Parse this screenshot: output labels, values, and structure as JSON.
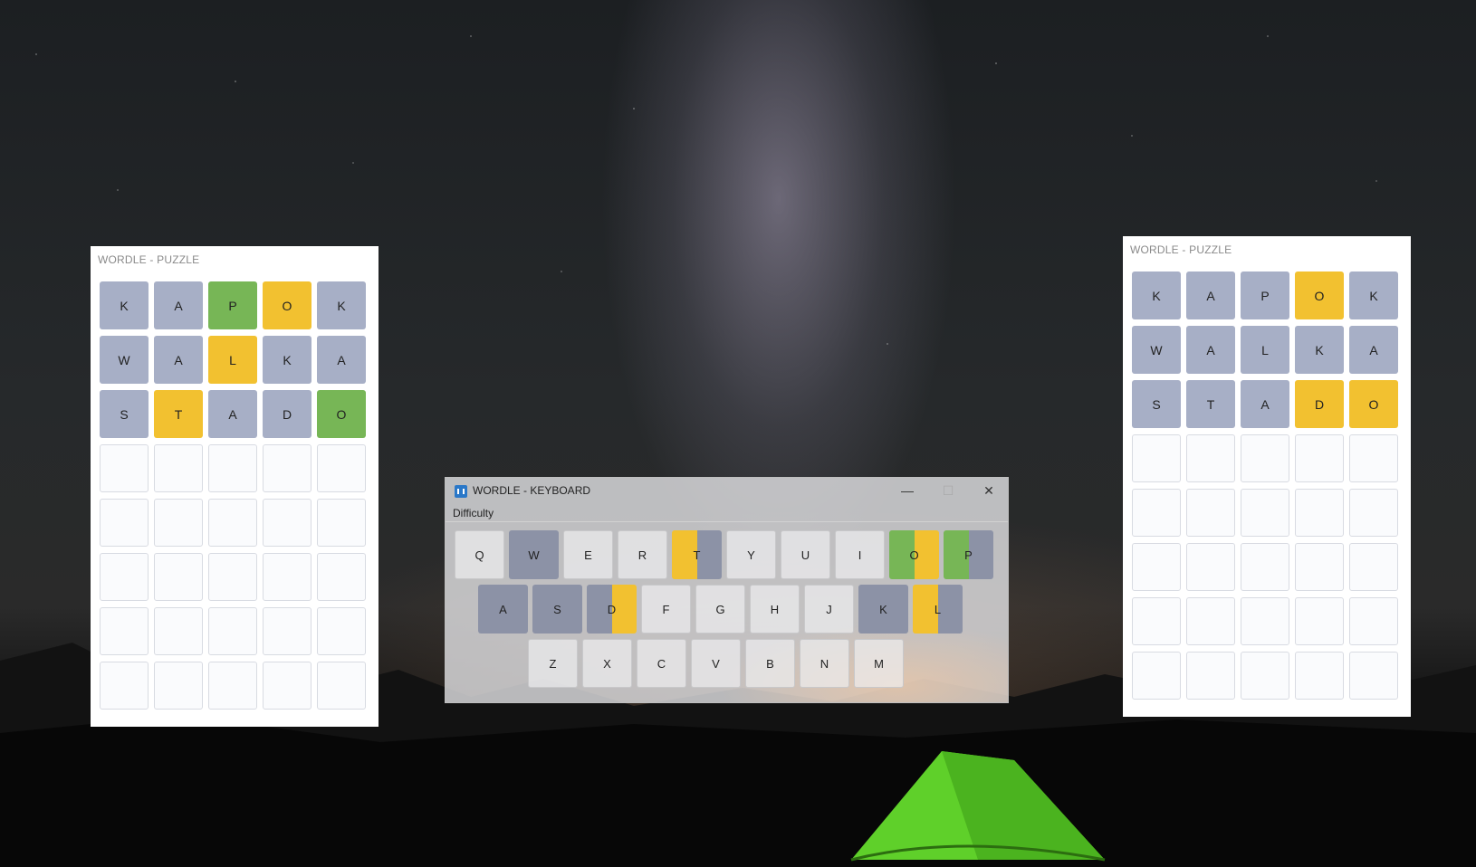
{
  "colors": {
    "gray": "#a7afc6",
    "yellow": "#f2c130",
    "green": "#77b656",
    "key_gray": "#8c92a6"
  },
  "left_puzzle": {
    "title": "WORDLE - PUZZLE",
    "rows": [
      [
        {
          "l": "K",
          "s": "gray"
        },
        {
          "l": "A",
          "s": "gray"
        },
        {
          "l": "P",
          "s": "green"
        },
        {
          "l": "O",
          "s": "yellow"
        },
        {
          "l": "K",
          "s": "gray"
        }
      ],
      [
        {
          "l": "W",
          "s": "gray"
        },
        {
          "l": "A",
          "s": "gray"
        },
        {
          "l": "L",
          "s": "yellow"
        },
        {
          "l": "K",
          "s": "gray"
        },
        {
          "l": "A",
          "s": "gray"
        }
      ],
      [
        {
          "l": "S",
          "s": "gray"
        },
        {
          "l": "T",
          "s": "yellow"
        },
        {
          "l": "A",
          "s": "gray"
        },
        {
          "l": "D",
          "s": "gray"
        },
        {
          "l": "O",
          "s": "green"
        }
      ]
    ]
  },
  "right_puzzle": {
    "title": "WORDLE - PUZZLE",
    "rows": [
      [
        {
          "l": "K",
          "s": "gray"
        },
        {
          "l": "A",
          "s": "gray"
        },
        {
          "l": "P",
          "s": "gray"
        },
        {
          "l": "O",
          "s": "yellow"
        },
        {
          "l": "K",
          "s": "gray"
        }
      ],
      [
        {
          "l": "W",
          "s": "gray"
        },
        {
          "l": "A",
          "s": "gray"
        },
        {
          "l": "L",
          "s": "gray"
        },
        {
          "l": "K",
          "s": "gray"
        },
        {
          "l": "A",
          "s": "gray"
        }
      ],
      [
        {
          "l": "S",
          "s": "gray"
        },
        {
          "l": "T",
          "s": "gray"
        },
        {
          "l": "A",
          "s": "gray"
        },
        {
          "l": "D",
          "s": "yellow"
        },
        {
          "l": "O",
          "s": "yellow"
        }
      ]
    ]
  },
  "keyboard_window": {
    "title": "WORDLE - KEYBOARD",
    "menu": {
      "difficulty": "Difficulty"
    },
    "controls": {
      "minimize": "—",
      "maximize": "☐",
      "close": "✕"
    },
    "rows": [
      [
        {
          "k": "Q",
          "s": [
            "plain"
          ]
        },
        {
          "k": "W",
          "s": [
            "gray"
          ]
        },
        {
          "k": "E",
          "s": [
            "plain"
          ]
        },
        {
          "k": "R",
          "s": [
            "plain"
          ]
        },
        {
          "k": "T",
          "s": [
            "yellow",
            "gray"
          ]
        },
        {
          "k": "Y",
          "s": [
            "plain"
          ]
        },
        {
          "k": "U",
          "s": [
            "plain"
          ]
        },
        {
          "k": "I",
          "s": [
            "plain"
          ]
        },
        {
          "k": "O",
          "s": [
            "green",
            "yellow"
          ]
        },
        {
          "k": "P",
          "s": [
            "green",
            "gray"
          ]
        }
      ],
      [
        {
          "k": "A",
          "s": [
            "gray"
          ]
        },
        {
          "k": "S",
          "s": [
            "gray"
          ]
        },
        {
          "k": "D",
          "s": [
            "gray",
            "yellow"
          ]
        },
        {
          "k": "F",
          "s": [
            "plain"
          ]
        },
        {
          "k": "G",
          "s": [
            "plain"
          ]
        },
        {
          "k": "H",
          "s": [
            "plain"
          ]
        },
        {
          "k": "J",
          "s": [
            "plain"
          ]
        },
        {
          "k": "K",
          "s": [
            "gray"
          ]
        },
        {
          "k": "L",
          "s": [
            "yellow",
            "gray"
          ]
        }
      ],
      [
        {
          "k": "Z",
          "s": [
            "plain"
          ]
        },
        {
          "k": "X",
          "s": [
            "plain"
          ]
        },
        {
          "k": "C",
          "s": [
            "plain"
          ]
        },
        {
          "k": "V",
          "s": [
            "plain"
          ]
        },
        {
          "k": "B",
          "s": [
            "plain"
          ]
        },
        {
          "k": "N",
          "s": [
            "plain"
          ]
        },
        {
          "k": "M",
          "s": [
            "plain"
          ]
        }
      ]
    ]
  }
}
